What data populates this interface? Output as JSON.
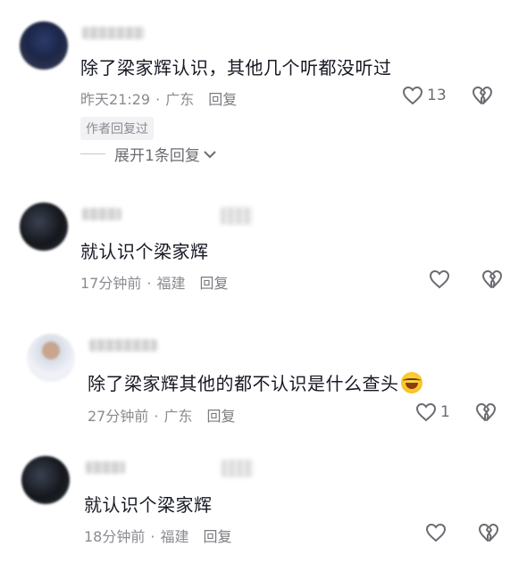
{
  "comments": [
    {
      "text": "除了梁家辉认识，其他几个听都没听过",
      "time": "昨天21:29",
      "location": "广东",
      "reply_label": "回复",
      "like_count": "13",
      "author_tag": "作者回复过",
      "expand_label": "展开1条回复"
    },
    {
      "text": "就认识个梁家辉",
      "time": "17分钟前",
      "location": "福建",
      "reply_label": "回复",
      "like_count": ""
    },
    {
      "text": "除了梁家辉其他的都不认识是什么查头",
      "time": "27分钟前",
      "location": "广东",
      "reply_label": "回复",
      "like_count": "1"
    },
    {
      "text": "就认识个梁家辉",
      "time": "18分钟前",
      "location": "福建",
      "reply_label": "回复",
      "like_count": ""
    }
  ],
  "icons": {
    "like": "heart-outline-icon",
    "dislike": "broken-heart-icon",
    "expand": "chevron-down-icon",
    "emoji": "rolling-laughing-emoji"
  },
  "colors": {
    "text": "#161823",
    "meta": "#8a8b91",
    "icon": "#6b6c72"
  }
}
